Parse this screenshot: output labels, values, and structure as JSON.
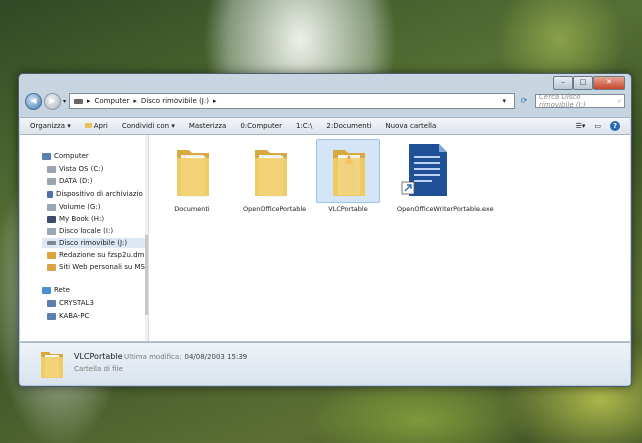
{
  "address": {
    "crumbs": [
      "Computer",
      "Disco rimovibile (J:)"
    ],
    "search_placeholder": "Cerca Disco rimovibile (J:)"
  },
  "toolbar": {
    "organize": "Organizza ▾",
    "open": "Apri",
    "share": "Condividi con ▾",
    "burn": "Masterizza",
    "t4": "0:Computer",
    "t5": "1:C:\\",
    "t6": "2:Documenti",
    "new_folder": "Nuova cartella"
  },
  "nav": {
    "items": [
      "Computer",
      "Vista OS (C:)",
      "DATA (D:)",
      "Dispositivo di archiviazio",
      "Volume (G:)",
      "My Book (H:)",
      "Disco locale (I:)",
      "Disco rimovibile (J:)",
      "Redazione su fzsp2u.dm",
      "Siti Web personali su MS",
      "Rete",
      "CRYSTAL3",
      "KABA-PC"
    ]
  },
  "files": [
    {
      "name": "Documenti"
    },
    {
      "name": "OpenOfficePortable"
    },
    {
      "name": "VLCPortable"
    },
    {
      "name": "OpenOfficeWriterPortable.exe"
    }
  ],
  "details": {
    "name": "VLCPortable",
    "modified_label": "Ultima modifica:",
    "modified_value": "04/08/2003 15:39",
    "type": "Cartella di file"
  }
}
